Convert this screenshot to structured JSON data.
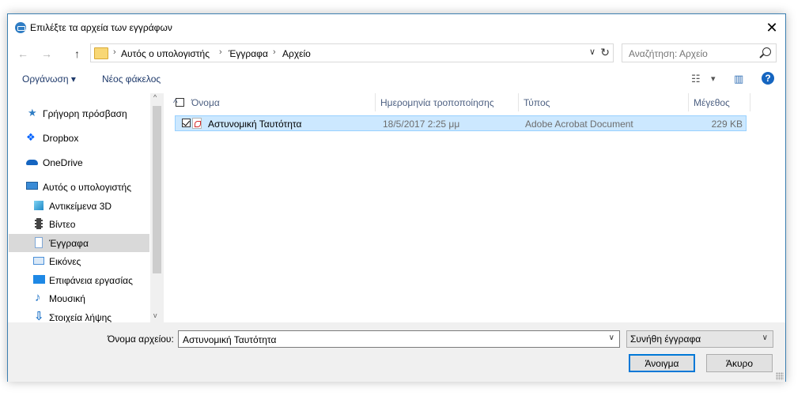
{
  "window": {
    "title": "Επιλέξτε τα αρχεία των εγγράφων",
    "close_glyph": "✕"
  },
  "navbar": {
    "back_glyph": "←",
    "forward_glyph": "→",
    "up_glyph": "↑",
    "breadcrumbs": [
      "Αυτός ο υπολογιστής",
      "Έγγραφα",
      "Αρχείο"
    ],
    "separator": "›",
    "dropdown_glyph": "∨",
    "refresh_glyph": "↻",
    "search_placeholder": "Αναζήτηση: Αρχείο"
  },
  "toolbar": {
    "organize_label": "Οργάνωση",
    "organize_caret": "▾",
    "new_folder_label": "Νέος φάκελος",
    "view_glyph": "☷",
    "view_caret": "▾",
    "pane_glyph": "▥",
    "help_glyph": "?"
  },
  "sidebar": {
    "items": [
      {
        "label": "Γρήγορη πρόσβαση",
        "icon": "star-icon",
        "color": "#2f7dc4"
      },
      {
        "label": "Dropbox",
        "icon": "dropbox-icon",
        "color": "#0061fe"
      },
      {
        "label": "OneDrive",
        "icon": "cloud-icon",
        "color": "#1565c0"
      },
      {
        "label": "Αυτός ο υπολογιστής",
        "icon": "computer-icon",
        "color": "#3a8bd6"
      },
      {
        "label": "Αντικείμενα 3D",
        "icon": "cube-icon",
        "color": "#3ab0e0"
      },
      {
        "label": "Βίντεο",
        "icon": "film-icon",
        "color": "#444444"
      },
      {
        "label": "Έγγραφα",
        "icon": "document-icon",
        "color": "#7fa7d6",
        "selected": true
      },
      {
        "label": "Εικόνες",
        "icon": "picture-icon",
        "color": "#4a90d9"
      },
      {
        "label": "Επιφάνεια εργασίας",
        "icon": "desktop-icon",
        "color": "#1e88e5"
      },
      {
        "label": "Μουσική",
        "icon": "music-icon",
        "color": "#1e73c8"
      },
      {
        "label": "Στοιχεία λήψης",
        "icon": "download-icon",
        "color": "#1e73c8"
      }
    ],
    "scroll_up_glyph": "^",
    "scroll_down_glyph": "v"
  },
  "file_list": {
    "columns": [
      "Όνομα",
      "Ημερομηνία τροποποίησης",
      "Τύπος",
      "Μέγεθος"
    ],
    "sort_glyph": "^",
    "rows": [
      {
        "name": "Αστυνομική Ταυτότητα",
        "modified": "18/5/2017 2:25 μμ",
        "type": "Adobe Acrobat Document",
        "size": "229 KB",
        "selected": true
      }
    ]
  },
  "bottom": {
    "filename_label": "Όνομα αρχείου:",
    "filename_value": "Αστυνομική Ταυτότητα",
    "dropdown_glyph": "∨",
    "filetype_value": "Συνήθη έγγραφα",
    "open_label": "Άνοιγμα",
    "cancel_label": "Άκυρο"
  }
}
